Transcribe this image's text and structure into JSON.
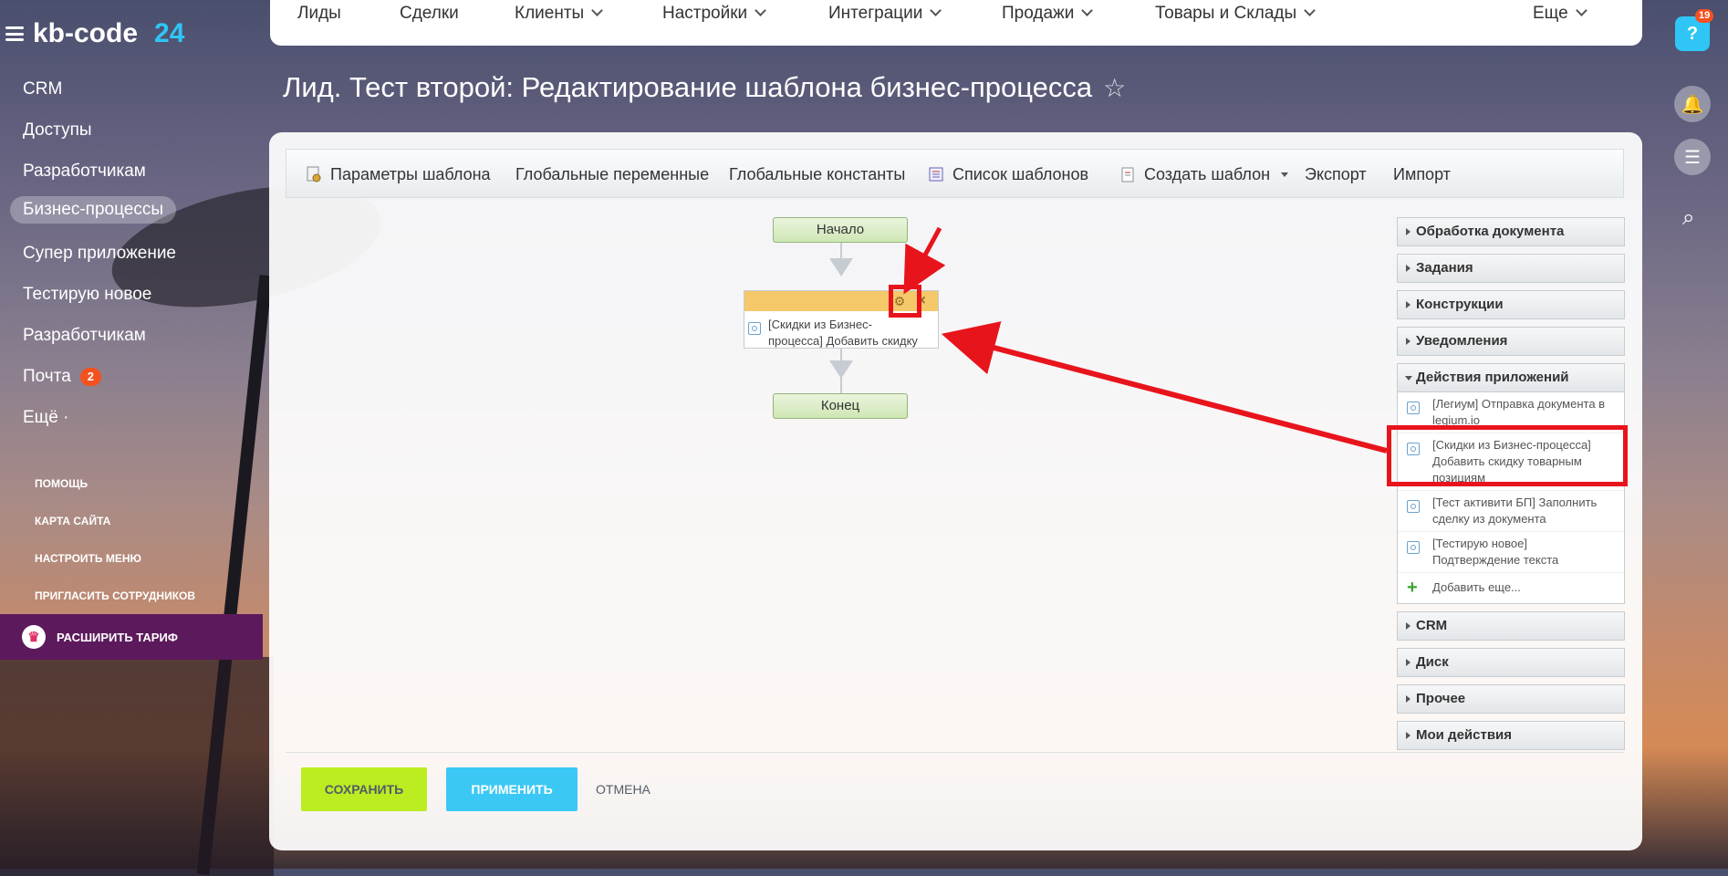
{
  "sidebar": {
    "logo_name": "kb-code",
    "logo_num": "24",
    "items": [
      {
        "label": "CRM"
      },
      {
        "label": "Доступы"
      },
      {
        "label": "Разработчикам"
      },
      {
        "label": "Бизнес-процессы"
      },
      {
        "label": "Супер приложение"
      },
      {
        "label": "Тестирую новое"
      },
      {
        "label": "Разработчикам"
      },
      {
        "label": "Почта",
        "badge": "2"
      },
      {
        "label": "Ещё ·"
      }
    ],
    "links": [
      "ПОМОЩЬ",
      "КАРТА САЙТА",
      "НАСТРОИТЬ МЕНЮ",
      "ПРИГЛАСИТЬ СОТРУДНИКОВ"
    ],
    "upgrade": "РАСШИРИТЬ ТАРИФ"
  },
  "topmenu": {
    "items": [
      "Лиды",
      "Сделки",
      "Клиенты",
      "Настройки",
      "Интеграции",
      "Продажи",
      "Товары и Склады"
    ],
    "more": "Еще"
  },
  "rightbar": {
    "help": "?",
    "help_badge": "19"
  },
  "page": {
    "title": "Лид. Тест второй: Редактирование шаблона бизнес-процесса",
    "star": "☆"
  },
  "toolbar": {
    "params": "Параметры шаблона",
    "global_vars": "Глобальные переменные",
    "global_consts": "Глобальные константы",
    "template_list": "Список шаблонов",
    "create_template": "Создать шаблон",
    "export": "Экспорт",
    "import": "Импорт"
  },
  "designer": {
    "start": "Начало",
    "end": "Конец",
    "activity_line1": "[Скидки из Бизнес-",
    "activity_line2": "процесса] Добавить скидку",
    "close": "×",
    "gear": "⚙"
  },
  "toolbox": {
    "groups": [
      "Обработка документа",
      "Задания",
      "Конструкции",
      "Уведомления",
      "Действия приложений",
      "CRM",
      "Диск",
      "Прочее",
      "Мои действия"
    ],
    "app_items": [
      {
        "line1": "[Легиум] Отправка документа в",
        "line2": "legium.io"
      },
      {
        "line1": "[Скидки из Бизнес-процесса]",
        "line2": "Добавить скидку товарным",
        "line3": "позициям"
      },
      {
        "line1": "[Тест активити БП] Заполнить",
        "line2": "сделку из документа"
      },
      {
        "line1": "[Тестирую новое]",
        "line2": "Подтверждение текста"
      }
    ],
    "add_more": "Добавить еще..."
  },
  "buttons": {
    "save": "СОХРАНИТЬ",
    "apply": "ПРИМЕНИТЬ",
    "cancel": "ОТМЕНА"
  },
  "colors": {
    "accent_blue": "#2fc6f6",
    "save_green": "#bbed21",
    "annotation_red": "#e8141c"
  }
}
